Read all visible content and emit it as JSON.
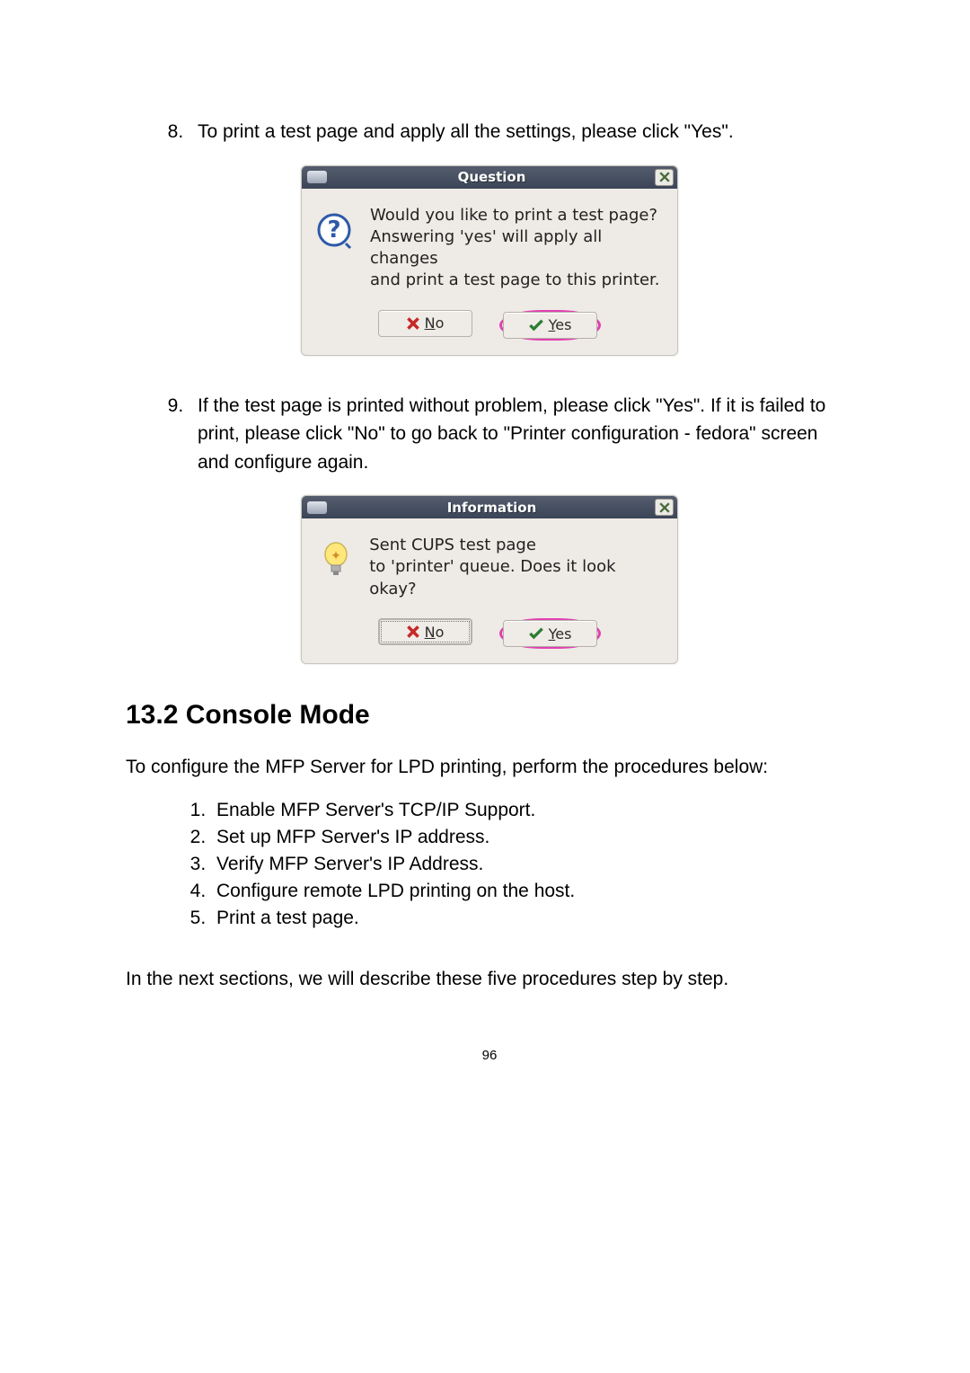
{
  "step8": {
    "text": "To print a test page and apply all the settings, please click \"Yes\"."
  },
  "dialog1": {
    "title": "Question",
    "message_l1": "Would you like to print a test page?",
    "message_l2": "Answering 'yes' will apply all changes",
    "message_l3": "and print a test page to this printer.",
    "no_letter": "N",
    "no_rest": "o",
    "yes_letter": "Y",
    "yes_rest": "es"
  },
  "step9": {
    "text": "If the test page is printed without problem, please click \"Yes\". If it is failed to print, please click \"No\" to go back to \"Printer configuration - fedora\" screen and configure again."
  },
  "dialog2": {
    "title": "Information",
    "message_l1": "Sent CUPS test page",
    "message_l2": "to 'printer' queue.  Does it look okay?",
    "no_letter": "N",
    "no_rest": "o",
    "yes_letter": "Y",
    "yes_rest": "es"
  },
  "heading": "13.2  Console Mode",
  "intro": "To configure the MFP Server for LPD printing, perform the procedures below:",
  "sublist": {
    "i1": "Enable MFP Server's TCP/IP Support.",
    "i2": "Set up MFP Server's IP address.",
    "i3": "Verify MFP Server's IP Address.",
    "i4": "Configure remote LPD printing on the host.",
    "i5": "Print a test page."
  },
  "outro": "In the next sections, we will describe these five procedures step by step.",
  "page_number": "96"
}
